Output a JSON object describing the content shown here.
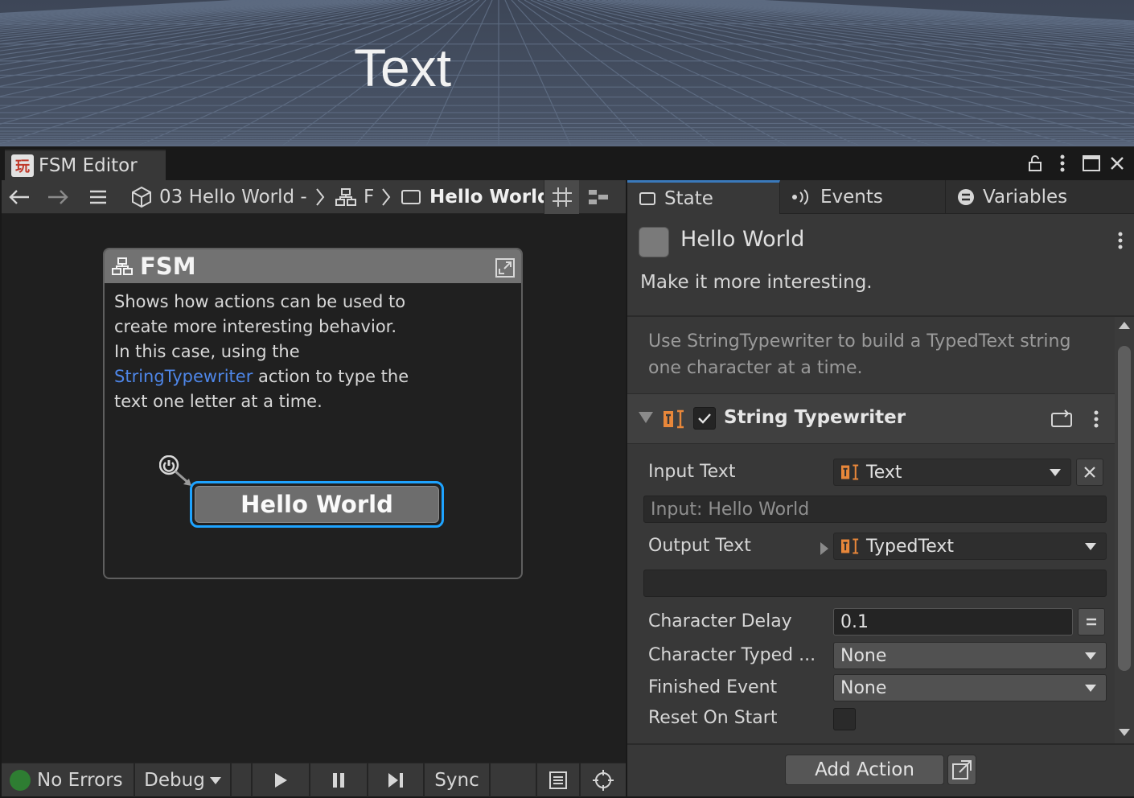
{
  "scene": {
    "text": "Text"
  },
  "window": {
    "tab_title": "FSM Editor",
    "tab_icon": "playmaker-logo-icon",
    "controls": [
      "lock-icon",
      "kebab-menu-icon",
      "maximize-icon",
      "close-icon"
    ]
  },
  "toolbar": {
    "breadcrumb": {
      "scene": "03 Hello World -",
      "fsm": "F",
      "state": "Hello World"
    }
  },
  "graph": {
    "fsm_title": "FSM",
    "description_before": "Shows how actions can be used to create more interesting behavior. In this case, using the ",
    "description_link": "StringTypewriter",
    "description_after": " action to type the text one letter at a time.",
    "state_label": "Hello World"
  },
  "statusbar": {
    "errors": "No Errors",
    "debug": "Debug",
    "sync": "Sync",
    "status_color": "#2e7d32"
  },
  "inspector": {
    "tabs": {
      "state": "State",
      "events": "Events",
      "variables": "Variables"
    },
    "state_name": "Hello World",
    "state_description": "Make it more interesting.",
    "hint": "Use StringTypewriter to build a TypedText string one character at a time.",
    "action_title": "String Typewriter",
    "action_enabled": true,
    "fields": {
      "input_text": {
        "label": "Input Text",
        "value": "Text"
      },
      "input_preview": "Input: Hello World",
      "output_text": {
        "label": "Output Text",
        "value": "TypedText"
      },
      "character_delay": {
        "label": "Character Delay",
        "value": "0.1"
      },
      "character_typed": {
        "label": "Character Typed ...",
        "value": "None"
      },
      "finished_event": {
        "label": "Finished Event",
        "value": "None"
      },
      "reset_on_start": {
        "label": "Reset On Start",
        "checked": false
      }
    },
    "add_action": "Add Action",
    "accent_color": "#1ea3ff",
    "action_icon_color": "#e8873a"
  }
}
